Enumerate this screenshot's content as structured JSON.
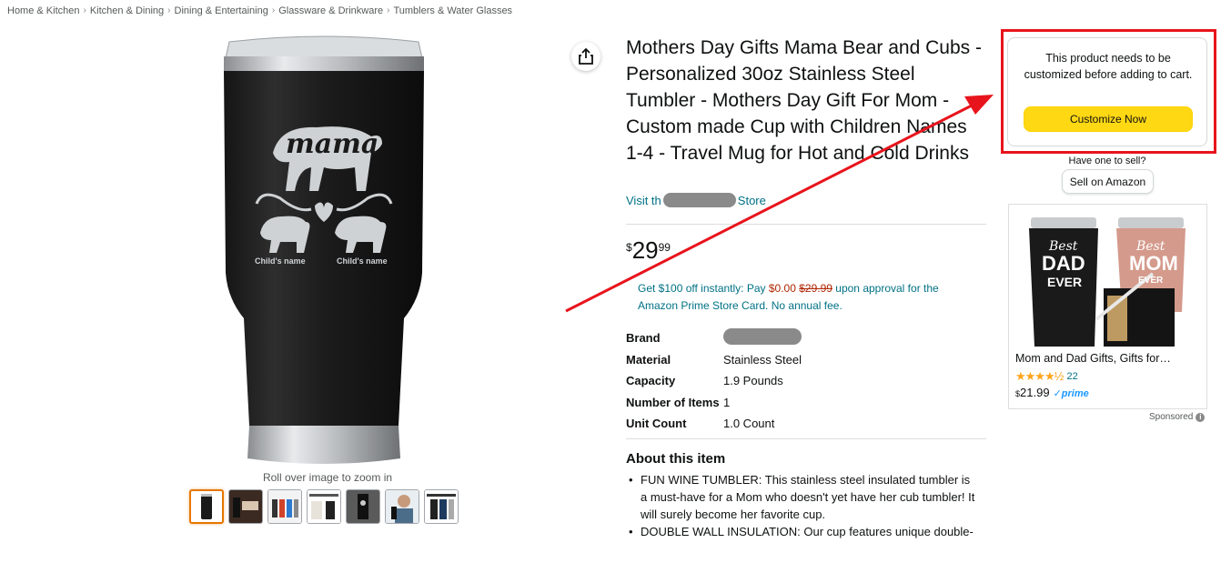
{
  "breadcrumb": [
    "Home & Kitchen",
    "Kitchen & Dining",
    "Dining & Entertaining",
    "Glassware & Drinkware",
    "Tumblers & Water Glasses"
  ],
  "breadcrumb_sep": "›",
  "product": {
    "title": "Mothers Day Gifts Mama Bear and Cubs - Personalized 30oz Stainless Steel Tumbler - Mothers Day Gift For Mom - Custom made Cup with Children Names 1-4 - Travel Mug for Hot and Cold Drinks",
    "store_prefix": "Visit th",
    "store_suffix": "Store",
    "image_text_main": "mama",
    "image_child_label_1": "Child's name",
    "image_child_label_2": "Child's name",
    "zoom_hint": "Roll over image to zoom in",
    "price": {
      "symbol": "$",
      "whole": "29",
      "fraction": "99"
    },
    "promo": {
      "part1": "Get $100 off instantly: Pay ",
      "pay_amount": "$0.00",
      "strike_amount": "$29.99",
      "part2": " upon approval for the Amazon Prime Store Card. No annual fee."
    },
    "specs": [
      {
        "key": "Brand",
        "value": ""
      },
      {
        "key": "Material",
        "value": "Stainless Steel"
      },
      {
        "key": "Capacity",
        "value": "1.9 Pounds"
      },
      {
        "key": "Number of Items",
        "value": "1"
      },
      {
        "key": "Unit Count",
        "value": "1.0 Count"
      }
    ],
    "about_title": "About this item",
    "about_items": [
      "FUN WINE TUMBLER: This stainless steel insulated tumbler is a must-have for a Mom who doesn't yet have her cub tumbler! It will surely become her favorite cup.",
      "DOUBLE WALL INSULATION: Our cup features unique double-"
    ]
  },
  "buybox": {
    "message": "This product needs to be customized before adding to cart.",
    "button": "Customize Now"
  },
  "sell": {
    "label": "Have one to sell?",
    "button": "Sell on Amazon"
  },
  "ad": {
    "title": "Mom and Dad Gifts, Gifts for…",
    "rating_count": "22",
    "stars": "★★★★½",
    "price_symbol": "$",
    "price": "21.99",
    "prime": "✓prime",
    "image_text_1": "Best",
    "image_text_2": "DAD",
    "image_text_3": "EVER",
    "image_text_4": "Best",
    "image_text_5": "MOM",
    "image_text_6": "EVER",
    "sponsored": "Sponsored"
  },
  "colors": {
    "highlight": "#e8141c",
    "customize_button": "#ffd814",
    "link": "#007185",
    "price_red": "#b12704"
  }
}
